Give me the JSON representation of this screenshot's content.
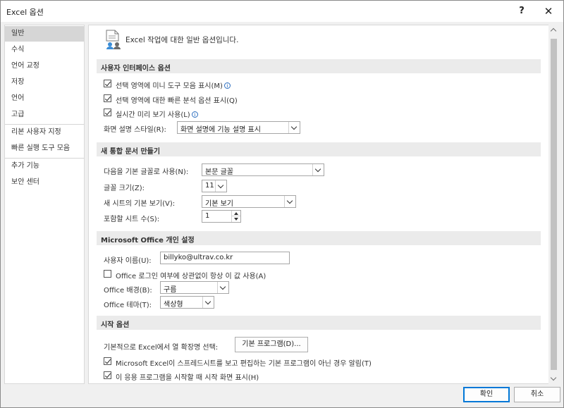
{
  "window": {
    "title": "Excel 옵션",
    "help_label": "?",
    "close_label": "✕"
  },
  "sidebar": {
    "items": [
      {
        "label": "일반",
        "selected": true
      },
      {
        "label": "수식"
      },
      {
        "label": "언어 교정"
      },
      {
        "label": "저장"
      },
      {
        "label": "언어"
      },
      {
        "label": "고급"
      },
      {
        "label": "리본 사용자 지정"
      },
      {
        "label": "빠른 실행 도구 모음"
      },
      {
        "label": "추가 기능"
      },
      {
        "label": "보안 센터"
      }
    ]
  },
  "content": {
    "intro": "Excel 작업에 대한 일반 옵션입니다.",
    "ui_section": {
      "header": "사용자 인터페이스 옵션",
      "mini_toolbar": {
        "label": "선택 영역에 미니 도구 모음 표시(M)",
        "checked": true
      },
      "quick_analysis": {
        "label": "선택 영역에 대한 빠른 분석 옵션 표시(Q)",
        "checked": true
      },
      "live_preview": {
        "label": "실시간 미리 보기 사용(L)",
        "checked": true
      },
      "screentip_label": "화면 설명 스타일(R):",
      "screentip_value": "화면 설명에 기능 설명 표시"
    },
    "new_workbook_section": {
      "header": "새 통합 문서 만들기",
      "default_font_label": "다음을 기본 글꼴로 사용(N):",
      "default_font_value": "본문 글꼴",
      "font_size_label": "글꼴 크기(Z):",
      "font_size_value": "11",
      "default_view_label": "새 시트의 기본 보기(V):",
      "default_view_value": "기본 보기",
      "sheet_count_label": "포함할 시트 수(S):",
      "sheet_count_value": "1"
    },
    "personalize_section": {
      "header": "Microsoft Office 개인 설정",
      "username_label": "사용자 이름(U):",
      "username_value": "billyko@ultrav.co.kr",
      "always_use": {
        "label": "Office 로그인 여부에 상관없이 항상 이 값 사용(A)",
        "checked": false
      },
      "background_label": "Office 배경(B):",
      "background_value": "구름",
      "theme_label": "Office 테마(T):",
      "theme_value": "색상형"
    },
    "startup_section": {
      "header": "시작 옵션",
      "extensions_label": "기본적으로 Excel에서 열 확장명 선택:",
      "default_programs_button": "기본 프로그램(D)...",
      "notify_default": {
        "label": "Microsoft Excel이 스프레드시트를 보고 편집하는 기본 프로그램이 아닌 경우 알림(T)",
        "checked": true
      },
      "show_start_screen": {
        "label": "이 응용 프로그램을 시작할 때 시작 화면 표시(H)",
        "checked": true
      }
    }
  },
  "footer": {
    "ok_label": "확인",
    "cancel_label": "취소"
  }
}
